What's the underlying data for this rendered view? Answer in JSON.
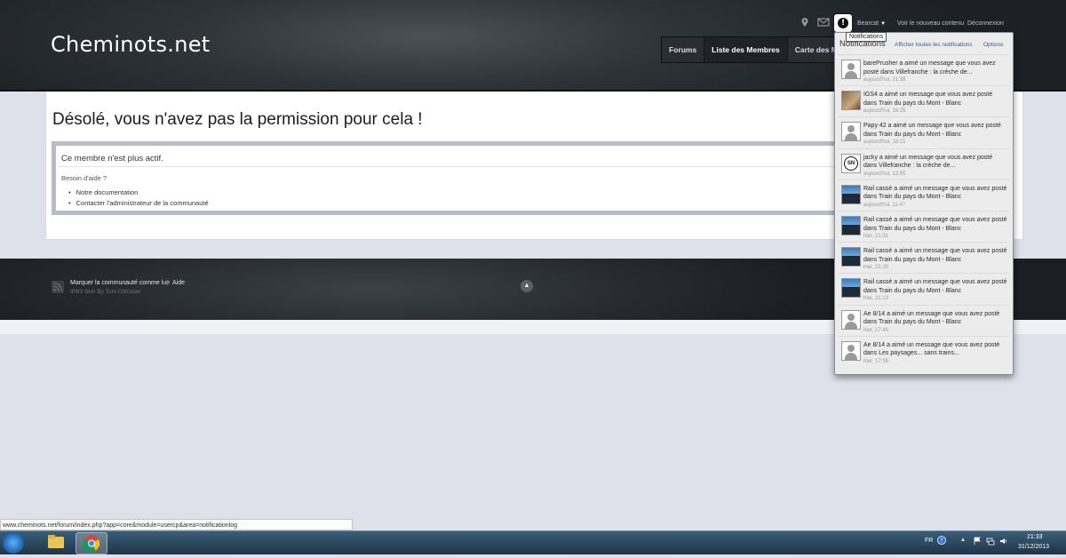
{
  "site": {
    "logo": "Cheminots.net"
  },
  "userbar": {
    "username": "Bearcat",
    "new_content": "Voir le nouveau contenu",
    "logout": "Déconnexion",
    "notif_tooltip": "Notifications"
  },
  "nav": {
    "tabs": [
      "Forums",
      "Liste des Membres",
      "Carte des Me"
    ]
  },
  "error": {
    "title": "Désolé, vous n'avez pas la permission pour cela !",
    "message": "Ce membre n'est plus actif.",
    "help_title": "Besoin d'aide ?",
    "help_links": [
      "Notre documentation",
      "Contacter l'administrateur de la communauté"
    ]
  },
  "footer": {
    "mark_read": "Marquer la communauté comme lue",
    "help": "Aide",
    "credit": "IPB3 Skin By Tom Christian",
    "separator": "|"
  },
  "notifications": {
    "title": "Notifications",
    "show_all": "Afficher toutes les notifications",
    "options": "Options",
    "items": [
      {
        "text": "barePrusher a aimé un message que vous avez posté dans Villefranche : la crèche de...",
        "time": "aujourd'hui, 21:38",
        "avatar": "default"
      },
      {
        "text": "IGS4 a aimé un message que vous avez posté dans Train du pays du Mont - Blanc",
        "time": "aujourd'hui, 18:25",
        "avatar": "photo"
      },
      {
        "text": "Papy 42 a aimé un message que vous avez posté dans Train du pays du Mont - Blanc",
        "time": "aujourd'hui, 18:21",
        "avatar": "default"
      },
      {
        "text": "jacky a aimé un message que vous avez posté dans Villefranche : la crèche de...",
        "time": "aujourd'hui, 12:55",
        "avatar": "badge"
      },
      {
        "text": "Rail cassé a aimé un message que vous avez posté dans Train du pays du Mont - Blanc",
        "time": "aujourd'hui, 11:47",
        "avatar": "train"
      },
      {
        "text": "Rail cassé a aimé un message que vous avez posté dans Train du pays du Mont - Blanc",
        "time": "hier, 21:31",
        "avatar": "train"
      },
      {
        "text": "Rail cassé a aimé un message que vous avez posté dans Train du pays du Mont - Blanc",
        "time": "hier, 21:20",
        "avatar": "train"
      },
      {
        "text": "Rail cassé a aimé un message que vous avez posté dans Train du pays du Mont - Blanc",
        "time": "hier, 21:13",
        "avatar": "train"
      },
      {
        "text": "Ae 8/14 a aimé un message que vous avez posté dans Train du pays du Mont - Blanc",
        "time": "hier, 17:46",
        "avatar": "default"
      },
      {
        "text": "Ae 8/14 a aimé un message que vous avez posté dans Les paysages... sans trains...",
        "time": "hier, 17:38",
        "avatar": "default"
      }
    ]
  },
  "statusbar": {
    "url": "www.cheminots.net/forum/index.php?app=core&module=usercp&area=notificationlog"
  },
  "taskbar": {
    "lang": "FR",
    "time": "21:33",
    "date": "31/12/2013",
    "badge_letters": "SN"
  }
}
